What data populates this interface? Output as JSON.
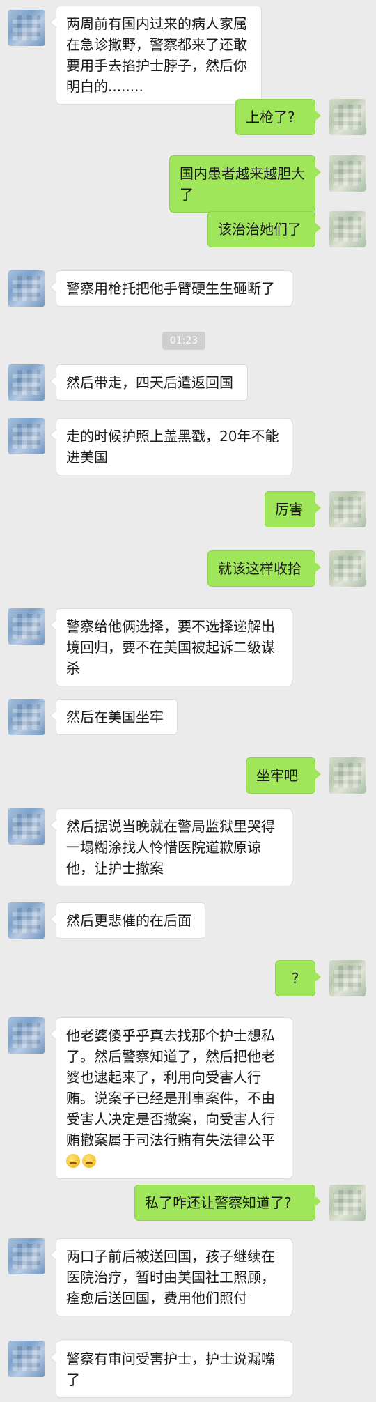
{
  "chat": {
    "timestamp": "01:23",
    "messages": [
      {
        "side": "left",
        "text": "两周前有国内过来的病人家属在急诊撒野，警察都来了还敢要用手去掐护士脖子，然后你明白的........"
      },
      {
        "side": "right",
        "text": "上枪了?"
      },
      {
        "side": "right",
        "text": "国内患者越来越胆大了"
      },
      {
        "side": "right",
        "text": "该治治她们了"
      },
      {
        "side": "left",
        "text": "警察用枪托把他手臂硬生生砸断了"
      },
      {
        "side": "left",
        "text": "然后带走，四天后遣返回国"
      },
      {
        "side": "left",
        "text": "走的时候护照上盖黑戳，20年不能进美国"
      },
      {
        "side": "right",
        "text": "厉害"
      },
      {
        "side": "right",
        "text": "就该这样收拾"
      },
      {
        "side": "left",
        "text": "警察给他俩选择，要不选择递解出境回归，要不在美国被起诉二级谋杀"
      },
      {
        "side": "left",
        "text": "然后在美国坐牢"
      },
      {
        "side": "right",
        "text": "坐牢吧"
      },
      {
        "side": "left",
        "text": "然后据说当晚就在警局监狱里哭得一塌糊涂找人怜惜医院道歉原谅他，让护士撤案"
      },
      {
        "side": "left",
        "text": "然后更悲催的在后面"
      },
      {
        "side": "right",
        "text": "?"
      },
      {
        "side": "left",
        "text": "他老婆傻乎乎真去找那个护士想私了。然后警察知道了，然后把他老婆也逮起来了，利用向受害人行贿。说案子已经是刑事案件，不由受害人决定是否撤案，向受害人行贿撤案属于司法行贿有失法律公平"
      },
      {
        "side": "right",
        "text": "私了咋还让警察知道了?"
      },
      {
        "side": "left",
        "text": "两口子前后被送回国，孩子继续在医院治疗，暂时由美国社工照顾，痊愈后送回国，费用他们照付"
      },
      {
        "side": "left",
        "text": "警察有审问受害护士，护士说漏嘴了"
      }
    ]
  },
  "icons": {
    "avatar_left": "blurred-avatar-blue-icon",
    "avatar_right": "blurred-avatar-green-icon",
    "emoji": "grimace-emoji-icon"
  },
  "colors": {
    "background": "#ebebeb",
    "bubble_left": "#ffffff",
    "bubble_right": "#9fe65a",
    "timestamp_bg": "#cfcfcf"
  }
}
